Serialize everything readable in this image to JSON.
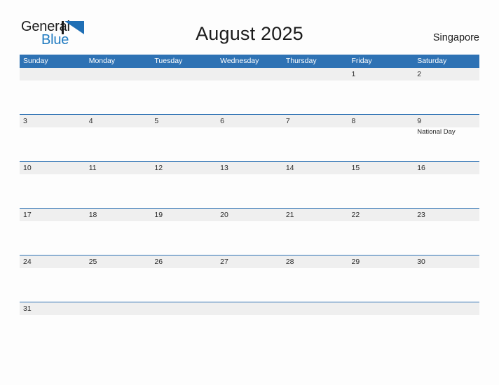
{
  "header": {
    "logo": {
      "word_one": "General",
      "word_two": "Blue",
      "mark_icon": "triangle-flag-icon"
    },
    "title": "August 2025",
    "region": "Singapore"
  },
  "colors": {
    "header_blue": "#2e72b4",
    "logo_blue": "#1f7ac0",
    "band_gray": "#efefef",
    "page_background": "#fdfdfd",
    "text": "#1b1b1b"
  },
  "calendar": {
    "day_headers": [
      "Sunday",
      "Monday",
      "Tuesday",
      "Wednesday",
      "Thursday",
      "Friday",
      "Saturday"
    ],
    "weeks": [
      {
        "days": [
          {
            "num": "",
            "event": ""
          },
          {
            "num": "",
            "event": ""
          },
          {
            "num": "",
            "event": ""
          },
          {
            "num": "",
            "event": ""
          },
          {
            "num": "",
            "event": ""
          },
          {
            "num": "1",
            "event": ""
          },
          {
            "num": "2",
            "event": ""
          }
        ]
      },
      {
        "days": [
          {
            "num": "3",
            "event": ""
          },
          {
            "num": "4",
            "event": ""
          },
          {
            "num": "5",
            "event": ""
          },
          {
            "num": "6",
            "event": ""
          },
          {
            "num": "7",
            "event": ""
          },
          {
            "num": "8",
            "event": ""
          },
          {
            "num": "9",
            "event": "National Day"
          }
        ]
      },
      {
        "days": [
          {
            "num": "10",
            "event": ""
          },
          {
            "num": "11",
            "event": ""
          },
          {
            "num": "12",
            "event": ""
          },
          {
            "num": "13",
            "event": ""
          },
          {
            "num": "14",
            "event": ""
          },
          {
            "num": "15",
            "event": ""
          },
          {
            "num": "16",
            "event": ""
          }
        ]
      },
      {
        "days": [
          {
            "num": "17",
            "event": ""
          },
          {
            "num": "18",
            "event": ""
          },
          {
            "num": "19",
            "event": ""
          },
          {
            "num": "20",
            "event": ""
          },
          {
            "num": "21",
            "event": ""
          },
          {
            "num": "22",
            "event": ""
          },
          {
            "num": "23",
            "event": ""
          }
        ]
      },
      {
        "days": [
          {
            "num": "24",
            "event": ""
          },
          {
            "num": "25",
            "event": ""
          },
          {
            "num": "26",
            "event": ""
          },
          {
            "num": "27",
            "event": ""
          },
          {
            "num": "28",
            "event": ""
          },
          {
            "num": "29",
            "event": ""
          },
          {
            "num": "30",
            "event": ""
          }
        ]
      },
      {
        "days": [
          {
            "num": "31",
            "event": ""
          },
          {
            "num": "",
            "event": ""
          },
          {
            "num": "",
            "event": ""
          },
          {
            "num": "",
            "event": ""
          },
          {
            "num": "",
            "event": ""
          },
          {
            "num": "",
            "event": ""
          },
          {
            "num": "",
            "event": ""
          }
        ]
      }
    ]
  }
}
